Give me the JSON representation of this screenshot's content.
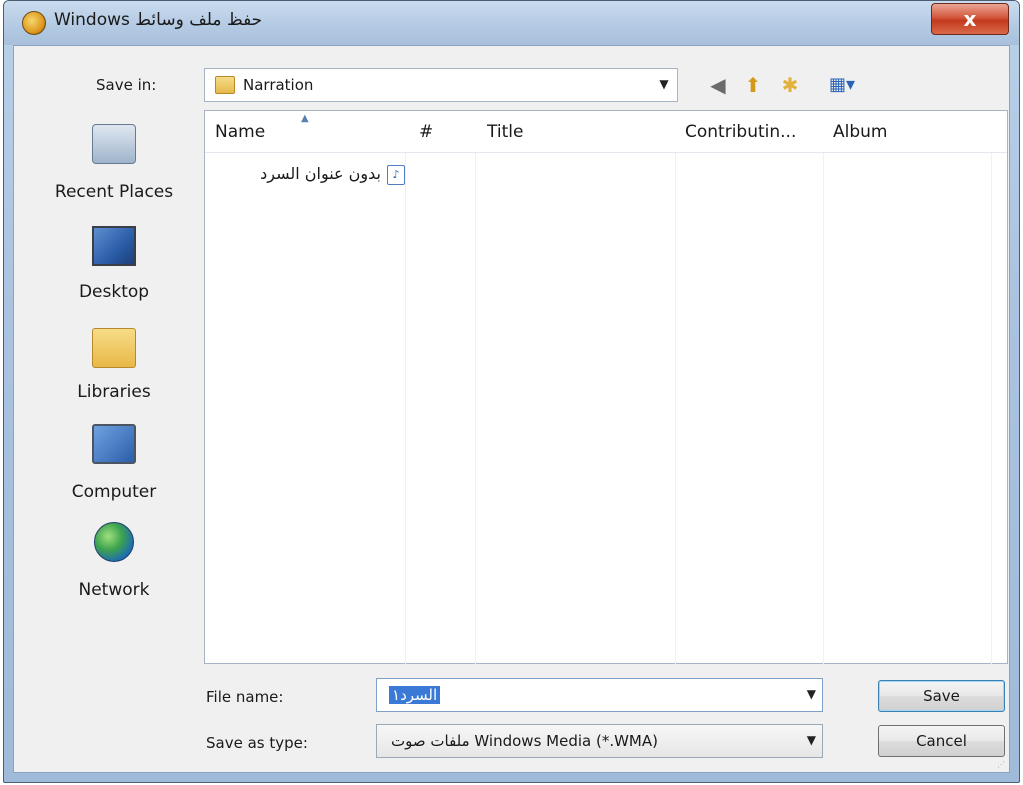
{
  "window": {
    "title": "Windows حفظ ملف وسائط",
    "close_label": "x"
  },
  "toolbar": {
    "save_in_label": "Save in:",
    "save_in_value": "Narration",
    "back_icon": "back-arrow-icon",
    "up_icon": "up-folder-icon",
    "new_folder_icon": "new-folder-icon",
    "views_icon": "views-menu-icon"
  },
  "places": [
    {
      "label": "Recent Places",
      "icon": "recent-places-icon"
    },
    {
      "label": "Desktop",
      "icon": "desktop-icon"
    },
    {
      "label": "Libraries",
      "icon": "libraries-icon"
    },
    {
      "label": "Computer",
      "icon": "computer-icon"
    },
    {
      "label": "Network",
      "icon": "network-icon"
    }
  ],
  "filelist": {
    "columns": [
      "Name",
      "#",
      "Title",
      "Contributin...",
      "Album"
    ],
    "files": [
      {
        "name": "بدون عنوان السرد",
        "icon": "audio-file-icon"
      }
    ]
  },
  "form": {
    "file_name_label": "File name:",
    "file_name_value": "السرد١",
    "save_type_label": "Save as type:",
    "save_type_value": "ملفات صوت Windows Media (*.WMA)",
    "save_button": "Save",
    "cancel_button": "Cancel"
  },
  "colors": {
    "titlebar": "#b5cbe4",
    "close_button": "#c33a1e",
    "selection": "#3b79d6"
  }
}
